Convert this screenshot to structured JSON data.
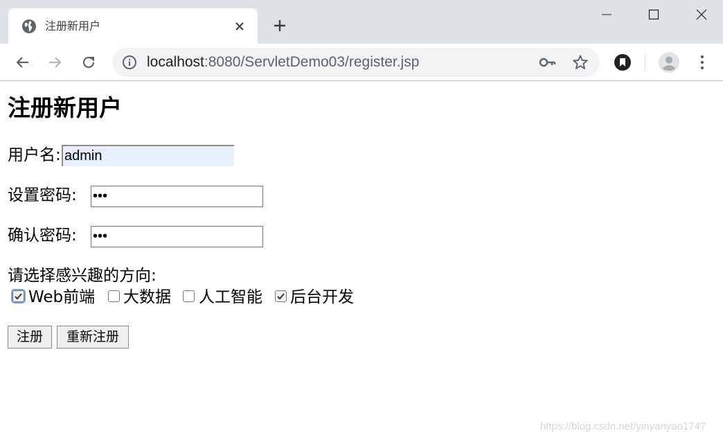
{
  "browser": {
    "tab_title": "注册新用户",
    "url_host": "localhost",
    "url_path": ":8080/ServletDemo03/register.jsp",
    "icons": {
      "favicon": "globe-icon",
      "tab_close": "close-icon",
      "new_tab": "plus-icon",
      "back": "back-arrow-icon",
      "forward": "forward-arrow-icon",
      "reload": "reload-icon",
      "site_info": "info-icon",
      "password": "key-icon",
      "bookmark": "star-icon",
      "extension": "bookmark-extension-icon",
      "profile": "profile-avatar-icon",
      "menu": "kebab-menu-icon"
    }
  },
  "page": {
    "heading": "注册新用户",
    "username_label": "用户名:",
    "username_value": "admin",
    "password_label": "设置密码:",
    "password_value": "•••",
    "confirm_label": "确认密码:",
    "confirm_value": "•••",
    "interest_prompt": "请选择感兴趣的方向:",
    "interests": [
      {
        "label": "Web前端",
        "checked": true
      },
      {
        "label": "大数据",
        "checked": false
      },
      {
        "label": "人工智能",
        "checked": false
      },
      {
        "label": "后台开发",
        "checked": true
      }
    ],
    "submit_label": "注册",
    "reset_label": "重新注册"
  },
  "watermark": "https://blog.csdn.net/yinyanyao1747"
}
